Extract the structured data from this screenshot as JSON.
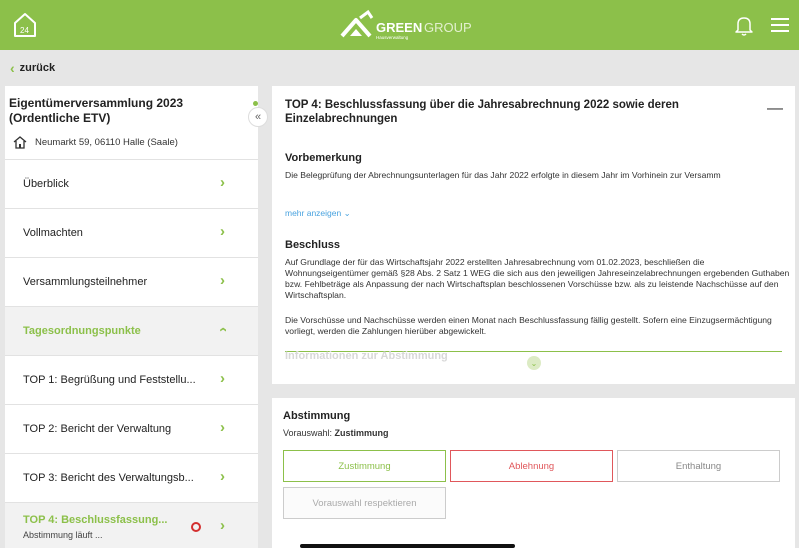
{
  "colors": {
    "brand_green": "#8cc04a",
    "red": "#e0575b",
    "link_blue": "#4aa3df"
  },
  "topbar": {
    "logo_text_green": "GREEN",
    "logo_text_group": "GROUP",
    "logo_sub": "Hausverwaltung",
    "home_icon_text": "24",
    "icons": [
      "home-24-icon",
      "greengroup-logo",
      "bell-icon",
      "hamburger-menu-icon"
    ]
  },
  "back": {
    "label": "zurück"
  },
  "sidebar": {
    "title": "Eigentümerversammlung 2023 (Ordentliche ETV)",
    "address": "Neumarkt 59, 06110 Halle (Saale)",
    "items": [
      {
        "label": "Überblick"
      },
      {
        "label": "Vollmachten"
      },
      {
        "label": "Versammlungsteilnehmer"
      },
      {
        "label": "Tagesordnungspunkte",
        "expanded": true
      },
      {
        "label": "TOP 1: Begrüßung und Feststellu..."
      },
      {
        "label": "TOP 2: Bericht der Verwaltung"
      },
      {
        "label": "TOP 3: Bericht des Verwaltungsb..."
      },
      {
        "label": "TOP 4: Beschlussfassung...",
        "sub": "Abstimmung läuft ...",
        "selected": true
      }
    ]
  },
  "detail": {
    "title": "TOP 4: Beschlussfassung über die Jahresabrechnung 2022 sowie deren Einzelabrechnungen",
    "vorbemerkung_h": "Vorbemerkung",
    "vorbemerkung_t": "Die Belegprüfung der Abrechnungsunterlagen für das Jahr 2022 erfolgte in diesem Jahr im Vorhinein zur Versamm",
    "mehr": "mehr anzeigen ⌄",
    "beschluss_h": "Beschluss",
    "beschluss_t1": "Auf Grundlage der für das Wirtschaftsjahr 2022 erstellten Jahresabrechnung vom 01.02.2023, beschließen die Wohnungseigentümer gemäß §28 Abs. 2 Satz 1 WEG die sich aus den jeweiligen Jahreseinzelabrechnungen ergebenden Guthaben bzw. Fehlbeträge als Anpassung der nach Wirtschaftsplan beschlossenen Vorschüsse bzw. als zu leistende Nachschüsse auf den Wirtschaftsplan.",
    "beschluss_t2": "Die Vorschüsse und Nachschüsse werden einen Monat nach Beschlussfassung fällig gestellt. Sofern eine Einzugsermächtigung vorliegt, werden die Zahlungen hierüber abgewickelt.",
    "info_h": "Informationen zur Abstimmung"
  },
  "vote": {
    "heading": "Abstimmung",
    "preselect_label": "Vorauswahl:",
    "preselect_value": "Zustimmung",
    "yes": "Zustimmung",
    "no": "Ablehnung",
    "abstain": "Enthaltung",
    "respect": "Vorauswahl respektieren"
  }
}
